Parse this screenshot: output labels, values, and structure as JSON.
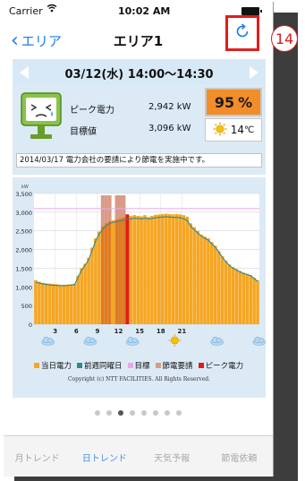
{
  "status_bar": {
    "carrier": "Carrier",
    "time": "10:02 AM"
  },
  "nav": {
    "back_label": "エリア",
    "title": "エリア1"
  },
  "annotation": {
    "callout": "14"
  },
  "date_bar": {
    "date_text": "03/12(水) 14:00～14:30"
  },
  "info": {
    "peak_label": "ピーク電力",
    "peak_value": "2,942 kW",
    "target_label": "目標値",
    "target_value": "3,096 kW",
    "usage_percent": "95",
    "usage_unit": "%",
    "temperature": "14",
    "temperature_unit": "℃",
    "notice": "2014/03/17 電力会社の要請により節電を実施中です。"
  },
  "chart_data": {
    "type": "bar",
    "y_unit_label": "kW",
    "ylim": [
      0,
      3500
    ],
    "y_ticks": [
      "0",
      "500",
      "1,000",
      "1,500",
      "2,000",
      "2,500",
      "3,000",
      "3,500"
    ],
    "x_ticks": [
      "3",
      "6",
      "9",
      "12",
      "15",
      "18",
      "21"
    ],
    "grid": true,
    "target_line": 3096,
    "series": [
      {
        "name": "当日電力",
        "color": "#f5a623",
        "values": [
          1180,
          1140,
          1110,
          1100,
          1090,
          1080,
          1070,
          1060,
          1060,
          1060,
          1070,
          1080,
          1300,
          1500,
          1620,
          1780,
          2050,
          2300,
          2480,
          2620,
          2700,
          2760,
          2780,
          2800,
          2830,
          2860,
          2890,
          2900,
          2920,
          2900,
          2890,
          2920,
          2870,
          2900,
          2930,
          2940,
          2950,
          2960,
          2950,
          2940,
          2950,
          2940,
          2920,
          2880,
          2700,
          2600,
          2500,
          2400,
          2350,
          2300,
          2200,
          2100,
          1960,
          1820,
          1700,
          1600,
          1530,
          1480,
          1430,
          1380,
          1350,
          1320,
          1250,
          1180
        ]
      },
      {
        "name": "前週同曜日",
        "color": "#2f8a8c",
        "values": [
          1120,
          1100,
          1080,
          1060,
          1050,
          1040,
          1040,
          1030,
          1030,
          1040,
          1050,
          1060,
          1250,
          1450,
          1580,
          1720,
          1980,
          2230,
          2410,
          2550,
          2640,
          2700,
          2730,
          2750,
          2770,
          2790,
          2810,
          2820,
          2840,
          2830,
          2820,
          2840,
          2820,
          2830,
          2850,
          2860,
          2870,
          2880,
          2870,
          2860,
          2860,
          2850,
          2820,
          2780,
          2620,
          2530,
          2440,
          2360,
          2300,
          2250,
          2150,
          2060,
          1930,
          1790,
          1670,
          1570,
          1500,
          1450,
          1400,
          1360,
          1330,
          1300,
          1220,
          1150
        ]
      }
    ],
    "demand_request_bars": [
      {
        "category": 19,
        "value": 3450
      },
      {
        "category": 20,
        "value": 3450
      },
      {
        "category": 21,
        "value": 3450
      },
      {
        "category": 23,
        "value": 3450
      },
      {
        "category": 24,
        "value": 3450
      },
      {
        "category": 25,
        "value": 3450
      }
    ],
    "peak_bar": {
      "category": 26,
      "value": 2942
    },
    "legend": [
      {
        "name": "当日電力",
        "color": "#f5a623"
      },
      {
        "name": "前週同曜日",
        "color": "#2f8a8c"
      },
      {
        "name": "目標",
        "color": "#e8a8e8"
      },
      {
        "name": "節電要請",
        "color": "#d99a85"
      },
      {
        "name": "ピーク電力",
        "color": "#e51a1a"
      }
    ],
    "weather_icons": [
      "cloud-icon",
      "cloud-icon",
      "cloud-icon",
      "sun-icon",
      "cloud-icon",
      "cloud-icon"
    ],
    "copyright": "Copyright (c) NTT FACILITIES. All Rights Reserved."
  },
  "page_indicator": {
    "count": 8,
    "active_index": 2
  },
  "tabs": [
    {
      "label": "月トレンド",
      "active": false
    },
    {
      "label": "日トレンド",
      "active": true
    },
    {
      "label": "天気予報",
      "active": false
    },
    {
      "label": "節電依頼",
      "active": false
    }
  ]
}
